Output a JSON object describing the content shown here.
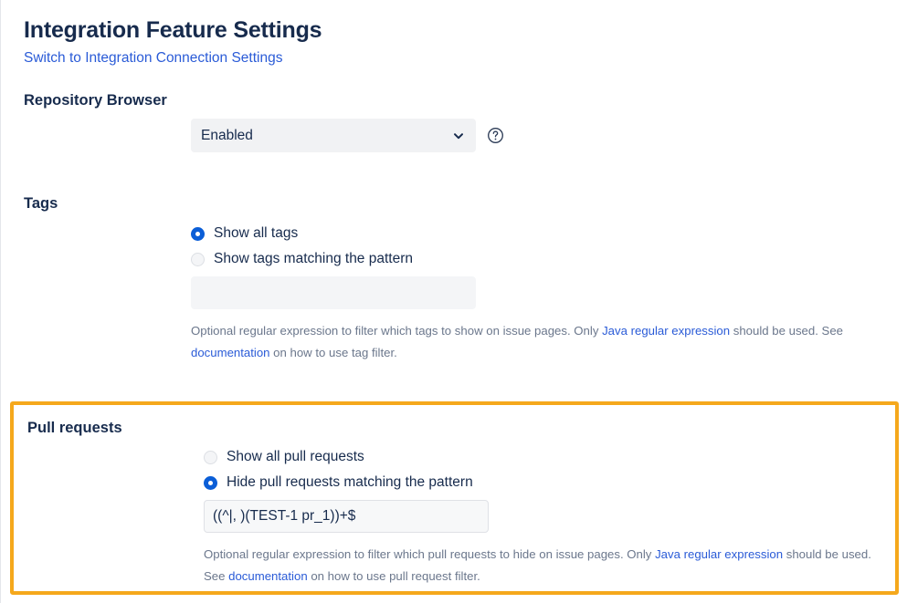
{
  "header": {
    "title": "Integration Feature Settings",
    "switch_link": "Switch to Integration Connection Settings"
  },
  "repository_browser": {
    "title": "Repository Browser",
    "select_value": "Enabled",
    "select_options": [
      "Enabled"
    ],
    "chevron_icon": "chevron-down-icon",
    "help_icon": "question-circle-icon"
  },
  "tags": {
    "title": "Tags",
    "options": [
      {
        "label": "Show all tags",
        "selected": true
      },
      {
        "label": "Show tags matching the pattern",
        "selected": false
      }
    ],
    "pattern_value": "",
    "pattern_placeholder": "",
    "help_part1": "Optional regular expression to filter which tags to show on issue pages. Only ",
    "help_link1": "Java regular expression",
    "help_part2": " should be used. See ",
    "help_link2": "documentation",
    "help_part3": " on how to use tag filter."
  },
  "pull_requests": {
    "title": "Pull requests",
    "options": [
      {
        "label": "Show all pull requests",
        "selected": false
      },
      {
        "label": "Hide pull requests matching the pattern",
        "selected": true
      }
    ],
    "pattern_value": "((^|, )(TEST-1 pr_1))+$",
    "pattern_placeholder": "",
    "help_part1": "Optional regular expression to filter which pull requests to hide on issue pages. Only ",
    "help_link1": "Java regular expression",
    "help_part2": " should be used. See ",
    "help_link2": "documentation",
    "help_part3": " on how to use pull request filter."
  },
  "colors": {
    "highlight_border": "#f5a81c",
    "link": "#2a5bd7",
    "heading": "#172B4D",
    "radio_selected": "#0b5ed7",
    "help_text": "#6b778c"
  }
}
